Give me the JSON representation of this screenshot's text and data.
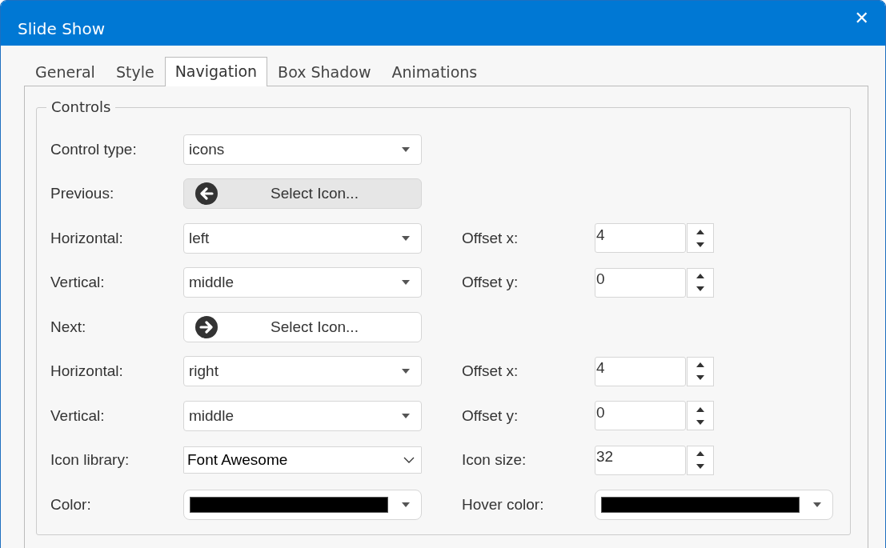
{
  "window": {
    "title": "Slide Show",
    "close": "✕"
  },
  "tabs": [
    {
      "label": "General",
      "selected": false
    },
    {
      "label": "Style",
      "selected": false
    },
    {
      "label": "Navigation",
      "selected": true
    },
    {
      "label": "Box Shadow",
      "selected": false
    },
    {
      "label": "Animations",
      "selected": false
    }
  ],
  "group": {
    "legend": "Controls"
  },
  "rows": [
    {
      "left": {
        "label": "Control type:",
        "kind": "dropdown",
        "value": "icons"
      }
    },
    {
      "left": {
        "label": "Previous:",
        "kind": "icon-button",
        "text": "Select Icon...",
        "pressed": true
      }
    },
    {
      "left": {
        "label": "Horizontal:",
        "kind": "dropdown",
        "value": "left"
      },
      "right": {
        "label": "Offset x:",
        "kind": "spinner",
        "value": "4"
      }
    },
    {
      "left": {
        "label": "Vertical:",
        "kind": "dropdown",
        "value": "middle"
      },
      "right": {
        "label": "Offset y:",
        "kind": "spinner",
        "value": "0"
      }
    },
    {
      "left": {
        "label": "Next:",
        "kind": "icon-button",
        "text": "Select Icon...",
        "pressed": false
      }
    },
    {
      "left": {
        "label": "Horizontal:",
        "kind": "dropdown",
        "value": "right"
      },
      "right": {
        "label": "Offset x:",
        "kind": "spinner",
        "value": "4"
      }
    },
    {
      "left": {
        "label": "Vertical:",
        "kind": "dropdown",
        "value": "middle"
      },
      "right": {
        "label": "Offset y:",
        "kind": "spinner",
        "value": "0"
      }
    },
    {
      "left": {
        "label": "Icon library:",
        "kind": "select",
        "value": "Font Awesome"
      },
      "right": {
        "label": "Icon size:",
        "kind": "spinner",
        "value": "32"
      }
    },
    {
      "left": {
        "label": "Color:",
        "kind": "color",
        "color": "#000000"
      },
      "right": {
        "label": "Hover color:",
        "kind": "color",
        "color": "#000000"
      }
    }
  ]
}
